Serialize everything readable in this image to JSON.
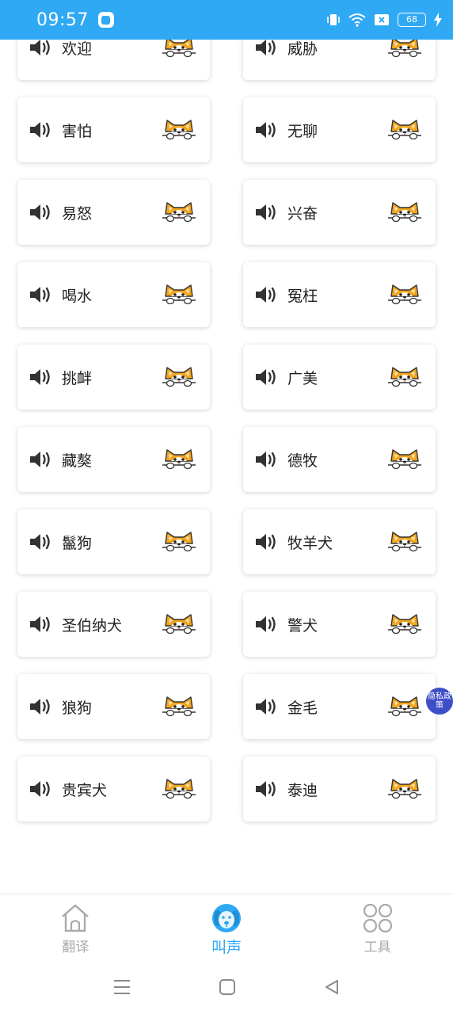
{
  "status_bar": {
    "time": "09:57",
    "battery": "68",
    "icons": [
      "vibrate-icon",
      "wifi-icon",
      "sim-x-icon",
      "battery-icon",
      "charging-icon"
    ]
  },
  "sounds": [
    {
      "label": "欢迎"
    },
    {
      "label": "威胁"
    },
    {
      "label": "害怕"
    },
    {
      "label": "无聊"
    },
    {
      "label": "易怒"
    },
    {
      "label": "兴奋"
    },
    {
      "label": "喝水"
    },
    {
      "label": "冤枉"
    },
    {
      "label": "挑衅"
    },
    {
      "label": "广美"
    },
    {
      "label": "藏獒"
    },
    {
      "label": "德牧"
    },
    {
      "label": "鬣狗"
    },
    {
      "label": "牧羊犬"
    },
    {
      "label": "圣伯纳犬"
    },
    {
      "label": "警犬"
    },
    {
      "label": "狼狗"
    },
    {
      "label": "金毛"
    },
    {
      "label": "贵宾犬"
    },
    {
      "label": "泰迪"
    }
  ],
  "privacy_badge": "隐私政策",
  "bottom_nav": {
    "items": [
      {
        "label": "翻译",
        "icon": "house-icon",
        "active": false
      },
      {
        "label": "叫声",
        "icon": "dog-icon",
        "active": true
      },
      {
        "label": "工具",
        "icon": "tools-grid-icon",
        "active": false
      }
    ]
  },
  "colors": {
    "accent": "#2fa9f3",
    "inactive": "#a9a9a9",
    "badge": "#3d4ec7",
    "dog_orange": "#f3a51c"
  }
}
